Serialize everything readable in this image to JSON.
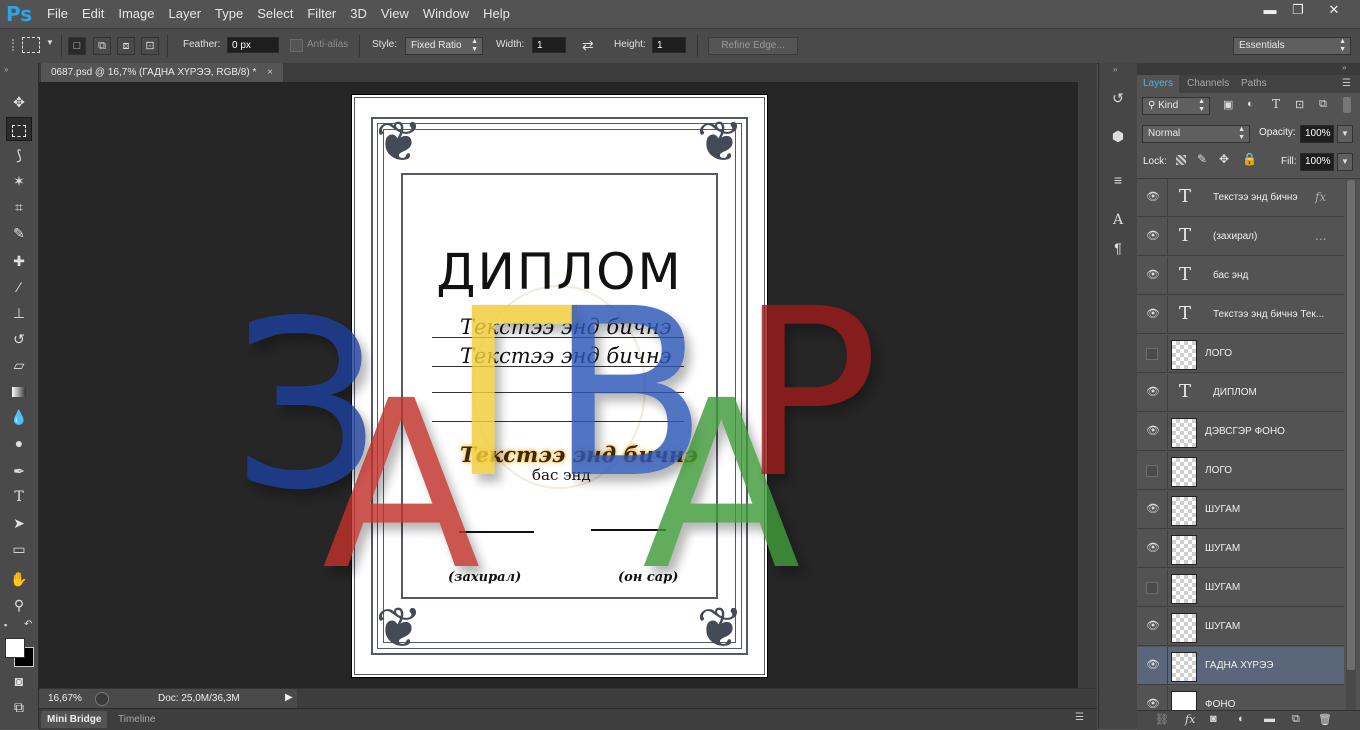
{
  "app": {
    "logo": "Ps"
  },
  "menu": [
    "File",
    "Edit",
    "Image",
    "Layer",
    "Type",
    "Select",
    "Filter",
    "3D",
    "View",
    "Window",
    "Help"
  ],
  "window_controls": {
    "minimize": "▬",
    "restore": "❐",
    "close": "✕"
  },
  "options": {
    "feather_label": "Feather:",
    "feather_value": "0 px",
    "antialias_label": "Anti-alias",
    "style_label": "Style:",
    "style_value": "Fixed Ratio",
    "width_label": "Width:",
    "width_value": "1",
    "height_label": "Height:",
    "height_value": "1",
    "refine_edge": "Refine Edge...",
    "workspace": "Essentials"
  },
  "document": {
    "tab_title": "0687.psd @ 16,7% (ГАДНА ХҮРЭЭ, RGB/8) *",
    "zoom": "16,67%",
    "doc_size": "Doc: 25,0M/36,3M"
  },
  "bottom_tabs": {
    "mini_bridge": "Mini Bridge",
    "timeline": "Timeline"
  },
  "diploma": {
    "title": "ДИПЛОМ",
    "line1": "Текстээ энд бичнэ",
    "line2": "Текстээ энд бичнэ",
    "line3": "Текстээ энд бичнэ",
    "place": "бас энд",
    "director": "(захирал)",
    "date": "(он сар)",
    "watermark_letters": [
      {
        "ch": "З",
        "color": "#1e3f9a"
      },
      {
        "ch": "А",
        "color": "#c0322a"
      },
      {
        "ch": "Г",
        "color": "#f2cd39"
      },
      {
        "ch": "В",
        "color": "#2c56b6"
      },
      {
        "ch": "А",
        "color": "#3f9a3a"
      },
      {
        "ch": "Р",
        "color": "#9b1c1c"
      }
    ]
  },
  "layers_panel": {
    "tabs": [
      "Layers",
      "Channels",
      "Paths"
    ],
    "kind": "Kind",
    "blend_mode": "Normal",
    "opacity_label": "Opacity:",
    "opacity_value": "100%",
    "lock_label": "Lock:",
    "fill_label": "Fill:",
    "fill_value": "100%",
    "layers": [
      {
        "name": "Текстээ энд бичнэ",
        "type": "text",
        "visible": true,
        "extra": "fx"
      },
      {
        "name": "(захирал)",
        "type": "text",
        "visible": true,
        "extra": "..."
      },
      {
        "name": "бас энд",
        "type": "text",
        "visible": true,
        "extra": ""
      },
      {
        "name": "Текстээ энд бичнэ Тек...",
        "type": "text",
        "visible": true,
        "extra": ""
      },
      {
        "name": "ЛОГО",
        "type": "raster",
        "visible": false,
        "extra": ""
      },
      {
        "name": "ДИПЛОМ",
        "type": "text",
        "visible": true,
        "extra": ""
      },
      {
        "name": "ДЭВСГЭР ФОНО",
        "type": "raster",
        "visible": true,
        "extra": ""
      },
      {
        "name": "ЛОГО",
        "type": "raster",
        "visible": false,
        "extra": ""
      },
      {
        "name": "ШУГАМ",
        "type": "raster",
        "visible": true,
        "extra": ""
      },
      {
        "name": "ШУГАМ",
        "type": "raster",
        "visible": true,
        "extra": ""
      },
      {
        "name": "ШУГАМ",
        "type": "raster",
        "visible": false,
        "extra": ""
      },
      {
        "name": "ШУГАМ",
        "type": "raster",
        "visible": true,
        "extra": ""
      },
      {
        "name": "ГАДНА ХҮРЭЭ",
        "type": "raster",
        "visible": true,
        "extra": "",
        "selected": true
      },
      {
        "name": "ФОНО",
        "type": "white",
        "visible": true,
        "extra": ""
      }
    ],
    "footer_icons": [
      "link-icon",
      "fx-icon",
      "mask-icon",
      "adjustment-icon",
      "folder-icon",
      "new-layer-icon",
      "trash-icon"
    ]
  },
  "colors": {
    "selected_layer": "#5a677a",
    "canvas_bg": "#262626",
    "ui_bg": "#535353",
    "logo": "#2fa3e8"
  }
}
